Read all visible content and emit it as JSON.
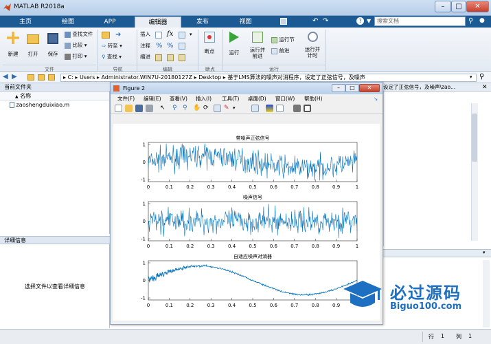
{
  "window": {
    "title": "MATLAB R2018a"
  },
  "tabs": [
    "主页",
    "绘图",
    "APP",
    "编辑器",
    "发布",
    "视图"
  ],
  "search": {
    "placeholder": "搜索文档"
  },
  "ribbon": {
    "file": {
      "new": "新建",
      "open": "打开",
      "save": "保存",
      "find_files": "查找文件",
      "compare": "比较",
      "print": "打印",
      "group": "文件"
    },
    "navigate": {
      "goto": "转至",
      "find": "查找",
      "group": "导航"
    },
    "edit": {
      "insert": "插入",
      "comment": "注释",
      "indent": "缩进",
      "fx": "fx",
      "group": "编辑"
    },
    "breakpoints": {
      "label": "断点",
      "group": "断点"
    },
    "run": {
      "run": "运行",
      "run_advance": "运行并\n前进",
      "run_section": "运行节",
      "advance": "前进",
      "run_time": "运行并\n计时",
      "group": "运行"
    }
  },
  "address": {
    "segments": [
      "C:",
      "Users",
      "Administrator.WIN7U-20180127Z",
      "Desktop",
      "基于LMS算法的噪声对消程序，设定了正弦信号，及噪声"
    ]
  },
  "current_folder": {
    "title": "当前文件夹",
    "col_name": "名称",
    "files": [
      "zaoshengduixiao.m"
    ]
  },
  "details": {
    "title": "详细信息",
    "empty": "选择文件以查看详细信息"
  },
  "right_panel": {
    "path_tail": "设定了正弦信号，及噪声\\zao..."
  },
  "figure": {
    "title": "Figure 2",
    "menu": [
      "文件(F)",
      "编辑(E)",
      "查看(V)",
      "插入(I)",
      "工具(T)",
      "桌面(D)",
      "窗口(W)",
      "帮助(H)"
    ]
  },
  "chart_data": [
    {
      "type": "line",
      "title": "带噪声正弦信号",
      "xlim": [
        0,
        1
      ],
      "ylim": [
        -1,
        1
      ],
      "xticks": [
        "0",
        "0.1",
        "0.2",
        "0.3",
        "0.4",
        "0.5",
        "0.6",
        "0.7",
        "0.8",
        "0.9",
        "1"
      ],
      "yticks": [
        "1",
        "0",
        "-1"
      ],
      "series": [
        {
          "color": "#0072bd",
          "kind": "sine_plus_noise"
        }
      ]
    },
    {
      "type": "line",
      "title": "噪声信号",
      "xlim": [
        0,
        1
      ],
      "ylim": [
        -1,
        1
      ],
      "xticks": [
        "0",
        "0.1",
        "0.2",
        "0.3",
        "0.4",
        "0.5",
        "0.6",
        "0.7",
        "0.8",
        "0.9",
        "1"
      ],
      "yticks": [
        "1",
        "0",
        "-1"
      ],
      "series": [
        {
          "color": "#0072bd",
          "kind": "noise"
        }
      ]
    },
    {
      "type": "line",
      "title": "自适应噪声对消器",
      "xlim": [
        0,
        1
      ],
      "ylim": [
        -1,
        1
      ],
      "xticks": [
        "0",
        "0.1",
        "0.2",
        "0.3",
        "0.4",
        "0.5",
        "0.6",
        "0.7",
        "0.8",
        "0.9"
      ],
      "yticks": [
        "1",
        "0",
        "-1"
      ],
      "series": [
        {
          "color": "#0072bd",
          "kind": "recovered_sine"
        }
      ]
    }
  ],
  "watermark": {
    "brand": "必过源码",
    "url": "Biguo100.com"
  },
  "statusbar": {
    "row_label": "行",
    "row": "1",
    "col_label": "列",
    "col": "1"
  }
}
